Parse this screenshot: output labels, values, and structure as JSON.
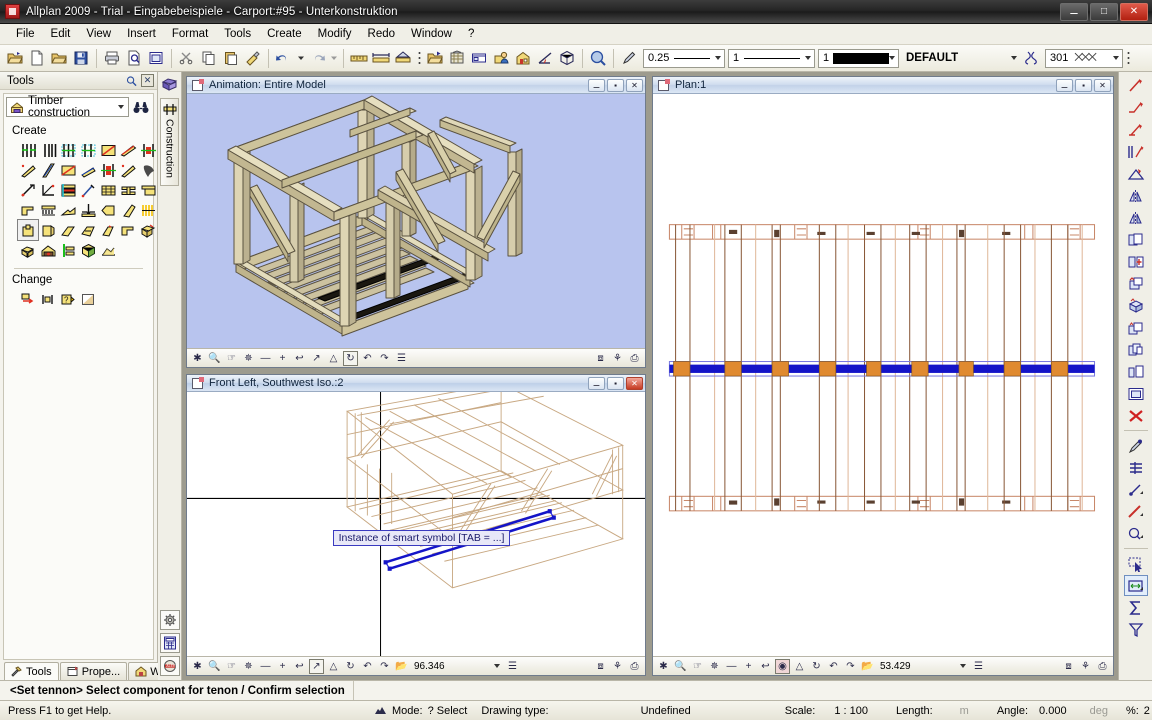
{
  "window": {
    "title": "Allplan 2009 - Trial - Eingabebeispiele - Carport:#95 - Unterkonstruktion",
    "minimize": "—",
    "maximize": "❐",
    "close": "✕"
  },
  "menubar": {
    "items": [
      "File",
      "Edit",
      "View",
      "Insert",
      "Format",
      "Tools",
      "Create",
      "Modify",
      "Redo",
      "Window",
      "?"
    ]
  },
  "toolbar": {
    "icons": [
      {
        "name": "open-project-icon",
        "glyph": "📂"
      },
      {
        "name": "new-file-icon",
        "glyph": "🗎"
      },
      {
        "name": "open-file-icon",
        "glyph": "📁"
      },
      {
        "name": "save-icon",
        "glyph": "💾"
      },
      {
        "name": "print-icon",
        "glyph": "🖨"
      },
      {
        "name": "print-preview-icon",
        "glyph": "🗋"
      },
      {
        "name": "print-layout-icon",
        "glyph": "▣"
      },
      {
        "name": "cut-icon",
        "glyph": "✂"
      },
      {
        "name": "copy-icon",
        "glyph": "⧉"
      },
      {
        "name": "paste-icon",
        "glyph": "📋"
      },
      {
        "name": "format-brush-icon",
        "glyph": "🖌"
      },
      {
        "name": "undo-icon",
        "glyph": "↶"
      },
      {
        "name": "redo-icon",
        "glyph": "↷"
      },
      {
        "name": "measure-length-icon",
        "glyph": "▤"
      },
      {
        "name": "measure-distance-icon",
        "glyph": "↔"
      },
      {
        "name": "measure-area-icon",
        "glyph": "▲"
      },
      {
        "name": "more-options-icon",
        "glyph": "⋮"
      },
      {
        "name": "open-drawing-file-icon",
        "glyph": "📂"
      },
      {
        "name": "layer-icon",
        "glyph": "🏛"
      },
      {
        "name": "plan-preview-icon",
        "glyph": "▦"
      },
      {
        "name": "teamwork-icon",
        "glyph": "👥"
      },
      {
        "name": "building-structure-icon",
        "glyph": "🏠"
      },
      {
        "name": "angle-icon",
        "glyph": "∠"
      },
      {
        "name": "cube-view-icon",
        "glyph": "⬡"
      },
      {
        "name": "help-search-icon",
        "glyph": "🔍"
      }
    ],
    "pen_picker_icon": "pen-icon",
    "line_weight": "0.25",
    "line_type": "1",
    "pen_color": "1",
    "layer": "DEFAULT",
    "layer_lock_icon": "layer-lock-icon",
    "hatch_style": "301",
    "hatch_sample": "⨉⨉⨉"
  },
  "tools_panel": {
    "header": "Tools",
    "header_icons": [
      "pin-icon",
      "close-icon"
    ],
    "category": "Timber construction",
    "category_icon": "timber-construction-icon",
    "search_icon": "binoculars-icon",
    "create_label": "Create",
    "change_label": "Change",
    "create_icons": [
      "wall-beam-pair-icon",
      "post-pair-icon",
      "beam-array-icon",
      "double-beam-icon",
      "diagonal-brace-icon",
      "rafter-icon",
      "purlin-joint-icon",
      "slanted-cut-icon",
      "bevel-beam-icon",
      "diagonal-member-icon",
      "angled-strut-icon",
      "beam-section-icon",
      "corner-joint-icon",
      "bird-mouth-icon",
      "strut-point-icon",
      "angle-brace-icon",
      "layered-beam-icon",
      "dowel-pin-icon",
      "grid-beam-icon",
      "double-t-beam-icon",
      "notch-beam-icon",
      "step-joint-icon",
      "comb-joint-icon",
      "scarf-joint-icon",
      "tenon-joint-icon",
      "half-lap-icon",
      "wedge-cut-icon",
      "finger-joint-icon",
      "mortise-icon",
      "dovetail-icon",
      "chamfer-icon",
      "rebate-icon",
      "tenon-cut-icon",
      "lap-joint-icon",
      "corner-cut-icon",
      "bevel-end-icon",
      "timber-roof-icon",
      "beam-connector-icon",
      "solid-body-icon",
      "roof-surface-icon"
    ],
    "selected_create_icon_index": 28,
    "change_icons": [
      "modify-component-icon",
      "align-beam-icon",
      "query-component-icon",
      "surface-properties-icon"
    ],
    "tabs": [
      {
        "label": "Tools",
        "icon": "tools-icon",
        "active": true
      },
      {
        "label": "Prope...",
        "icon": "properties-icon",
        "active": false
      },
      {
        "label": "Wizar...",
        "icon": "wizard-icon",
        "active": false
      }
    ]
  },
  "vstrip": {
    "top_icons": [
      "binoculars-icon"
    ],
    "palette_icon": "palette-stack-icon",
    "tab_icon": "construction-tab-icon",
    "tab_label": "Construction",
    "bottom_icons": [
      "gear-icon",
      "calculator-icon",
      "alert-icon"
    ]
  },
  "viewports": [
    {
      "name": "animation",
      "title": "Animation: Entire Model",
      "active": false,
      "footer_icons": [
        "snap-icon",
        "zoom-icon",
        "pan-icon",
        "sun-icon",
        "zoom-out-icon",
        "zoom-in-icon",
        "previous-view-icon",
        "zoom-window-icon",
        "home-view-icon",
        "refresh-icon",
        "undo-view-icon",
        "redo-view-icon",
        "save-view-icon"
      ],
      "footer_right_icons": [
        "window-copy-icon",
        "split-icon",
        "new-window-icon"
      ],
      "selected_footer_icon": "refresh-icon"
    },
    {
      "name": "front-left-southwest-iso",
      "title": "Front Left, Southwest Iso.:2",
      "active": true,
      "zoom_value": "96.346",
      "tooltip": "Instance of smart symbol [TAB = ...]",
      "footer_icons": [
        "snap-icon",
        "zoom-icon",
        "pan-icon",
        "sun-icon",
        "zoom-out-icon",
        "zoom-in-icon",
        "previous-view-icon",
        "zoom-window-icon",
        "home-view-icon",
        "refresh-icon",
        "undo-view-icon",
        "redo-view-icon",
        "open-view-icon"
      ],
      "footer_right_icons": [
        "window-copy-icon",
        "split-icon",
        "new-window-icon"
      ],
      "selected_footer_icon": "zoom-window-icon"
    },
    {
      "name": "plan",
      "title": "Plan:1",
      "active": false,
      "zoom_value": "53.429",
      "footer_icons": [
        "snap-icon",
        "zoom-icon",
        "pan-icon",
        "sun-icon",
        "zoom-out-icon",
        "zoom-in-icon",
        "previous-view-icon",
        "zoom-window-icon",
        "home-view-icon",
        "refresh-icon",
        "undo-view-icon",
        "redo-view-icon",
        "open-view-icon"
      ],
      "footer_right_icons": [
        "window-copy-icon",
        "split-icon",
        "new-window-icon"
      ],
      "selected_footer_icon": "zoom-window-icon"
    }
  ],
  "right_toolbar": {
    "icons": [
      "draw-line-icon",
      "draw-polyline-icon",
      "parallel-lines-icon",
      "multi-parallel-icon",
      "fillet-icon",
      "mirror-icon",
      "mirror-copy-icon",
      "copy-icon",
      "insert-element-icon",
      "move-copy-icon",
      "rotate-copy-icon",
      "stretch-copy-icon",
      "duplicate-icon",
      "align-icon",
      "frame-icon",
      "delete-icon",
      "pipette-icon",
      "modify-format-icon",
      "modify-point-icon",
      "modify-line-icon",
      "modify-element-icon",
      "select-arrow-icon",
      "measure-element-icon",
      "sum-icon",
      "filter-icon"
    ],
    "selected_icon": "measure-element-icon"
  },
  "prompt": {
    "text": "<Set tennon> Select component for tenon / Confirm selection"
  },
  "statusbar": {
    "help_text": "Press F1 to get Help.",
    "mode_icon": "mode-icon",
    "mode_label": "Mode:",
    "mode_value": "? Select",
    "drawing_type_label": "Drawing type:",
    "drawing_type_value": "Undefined",
    "scale_label": "Scale:",
    "scale_value": "1 : 100",
    "length_label": "Length:",
    "length_unit": "m",
    "angle_label": "Angle:",
    "angle_value": "0.000",
    "angle_unit": "deg",
    "percent_label": "%:",
    "percent_value": "2"
  },
  "colors": {
    "timber_fill": "#d8cfa8",
    "timber_edge": "#5a5240",
    "animation_bg": "#b8c4ee",
    "plan_line": "#c8886a",
    "plan_highlight": "#1414c8",
    "selection_blue": "#1414c8",
    "title_bg": "#1b1b1b"
  }
}
